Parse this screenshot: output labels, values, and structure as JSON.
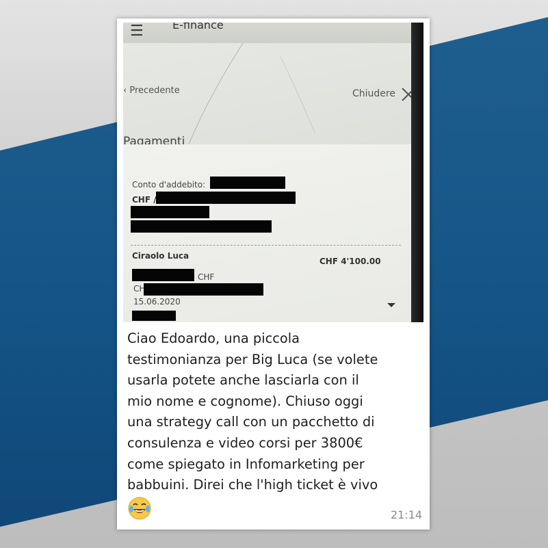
{
  "phone_header": {
    "menu_glyph": "☰",
    "title_fragment": "E-finance"
  },
  "navigation": {
    "back_label": "Precedente",
    "close_label": "Chiudere"
  },
  "payments": {
    "section_title": "Pagamenti",
    "debit_account_label": "Conto d'addebito:",
    "currency_prefix": "CHF /",
    "recipient_name": "Ciraolo Luca",
    "amount": "CHF 4'100.00",
    "currency_suffix": "CHF",
    "iban_prefix": "CH",
    "date": "15.06.2020"
  },
  "message": {
    "lines": [
      "Ciao Edoardo, una piccola",
      "testimonianza per Big Luca (se volete",
      "usarla potete anche lasciarla con il",
      "mio nome e cognome). Chiuso oggi",
      "una strategy call con un pacchetto di",
      "consulenza e video corsi per 3800€",
      "come spiegato in Infomarketing per",
      "babbuini. Direi che l'high ticket è vivo"
    ],
    "emoji": "face-with-tears-of-joy-icon",
    "time": "21:14"
  },
  "colors": {
    "background_band": "#155486",
    "card": "#ffffff",
    "redaction": "#050505",
    "timestamp": "#8a8a8a"
  }
}
